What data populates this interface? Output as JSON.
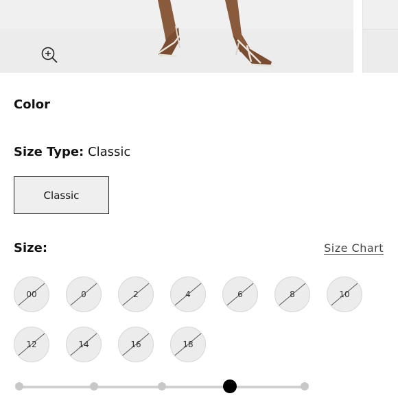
{
  "product": {
    "color_label": "Color",
    "size_type_label": "Size Type:",
    "size_type_value": "Classic",
    "size_type_options": [
      "Classic"
    ],
    "size_label": "Size:",
    "size_chart_link": "Size Chart",
    "sizes": [
      {
        "label": "00",
        "available": false
      },
      {
        "label": "0",
        "available": false
      },
      {
        "label": "2",
        "available": false
      },
      {
        "label": "4",
        "available": false
      },
      {
        "label": "6",
        "available": false
      },
      {
        "label": "8",
        "available": false
      },
      {
        "label": "10",
        "available": false
      },
      {
        "label": "12",
        "available": false
      },
      {
        "label": "14",
        "available": false
      },
      {
        "label": "16",
        "available": false
      },
      {
        "label": "18",
        "available": false
      }
    ]
  },
  "carousel": {
    "slide_count": 5,
    "active_index": 3
  },
  "icons": {
    "zoom": "zoom-in-icon"
  }
}
